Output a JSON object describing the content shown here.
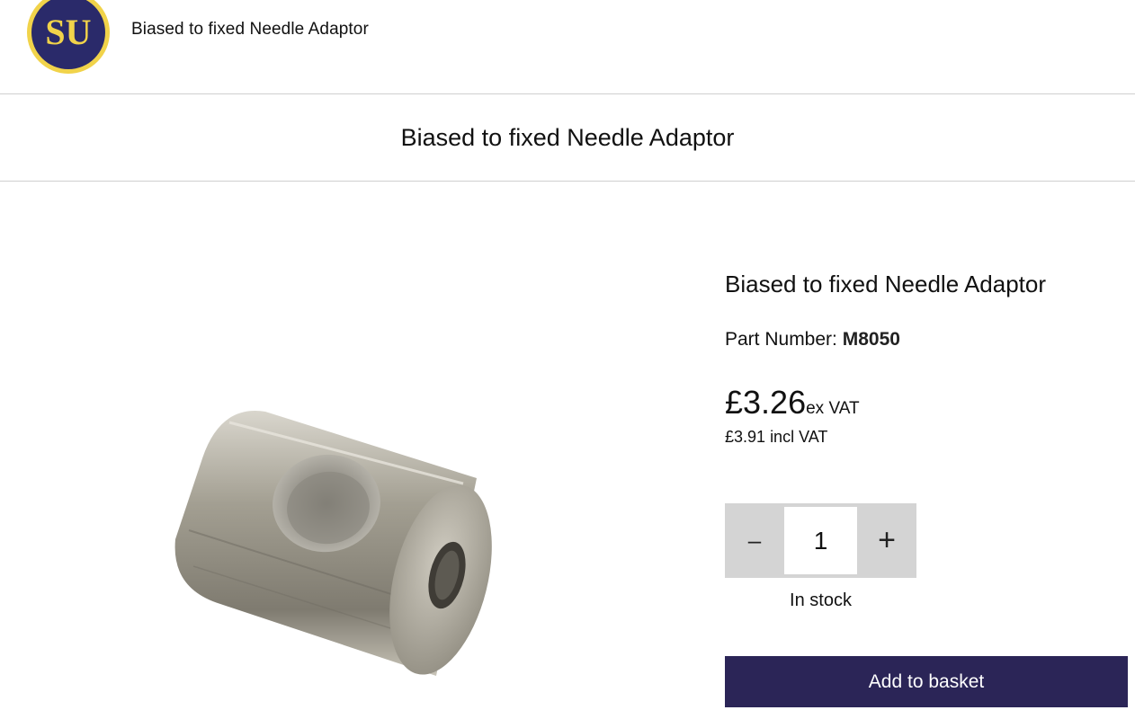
{
  "header": {
    "logo_text": "SU",
    "title": "Biased to fixed Needle Adaptor"
  },
  "page": {
    "title": "Biased to fixed Needle Adaptor"
  },
  "product": {
    "name": "Biased to fixed Needle Adaptor",
    "part_label": "Part Number:",
    "part_number": "M8050",
    "price_ex_vat": "£3.26",
    "price_ex_label": "ex VAT",
    "price_incl_vat": "£3.91",
    "price_incl_label": "incl VAT",
    "quantity": "1",
    "minus_label": "–",
    "plus_label": "+",
    "stock_status": "In stock",
    "add_to_basket_label": "Add to basket"
  },
  "colors": {
    "brand_navy": "#2b2557",
    "logo_gold": "#f1d34a",
    "qty_background": "#d4d4d4"
  },
  "icons": {
    "logo": "su-logo",
    "product_image": "needle-adaptor-photo"
  }
}
